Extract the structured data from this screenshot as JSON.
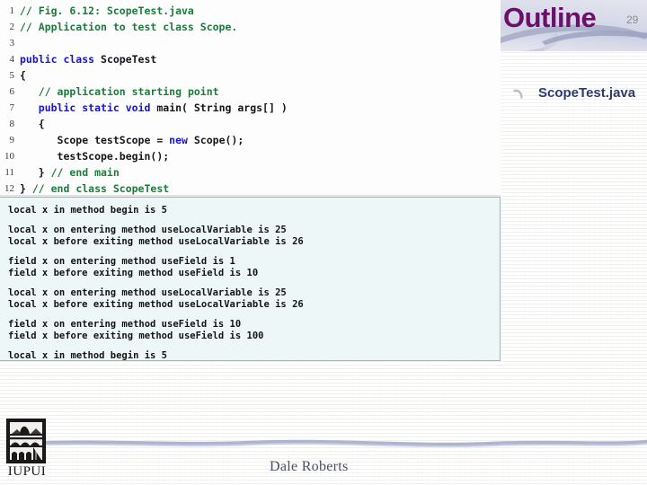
{
  "slide": {
    "page_number": "29",
    "author": "Dale Roberts"
  },
  "header": {
    "title": "Outline",
    "title_color": "#6b0f6b",
    "banner_color": "#d7d9e8"
  },
  "outline": {
    "items": [
      {
        "bullet_icon": "curved-arc-bullet-icon",
        "label": "ScopeTest.java"
      }
    ],
    "label_color": "#313a6e"
  },
  "code_panel": {
    "background": "#fdfdfd",
    "comment_color": "#1d7a3c",
    "keyword_color": "#1616c8",
    "plain_color": "#14161a",
    "lines": [
      {
        "n": "1",
        "segments": [
          {
            "t": "// Fig. 6.12: ScopeTest.java",
            "c": "cmt"
          }
        ]
      },
      {
        "n": "2",
        "segments": [
          {
            "t": "// Application to test class Scope.",
            "c": "cmt"
          }
        ]
      },
      {
        "n": "3",
        "segments": [
          {
            "t": "",
            "c": "pl"
          }
        ]
      },
      {
        "n": "4",
        "segments": [
          {
            "t": "public class ",
            "c": "kw"
          },
          {
            "t": "ScopeTest",
            "c": "pl"
          }
        ]
      },
      {
        "n": "5",
        "segments": [
          {
            "t": "{",
            "c": "pl"
          }
        ]
      },
      {
        "n": "6",
        "segments": [
          {
            "t": "   ",
            "c": "pl"
          },
          {
            "t": "// application starting point",
            "c": "cmt"
          }
        ]
      },
      {
        "n": "7",
        "segments": [
          {
            "t": "   ",
            "c": "pl"
          },
          {
            "t": "public static void ",
            "c": "kw"
          },
          {
            "t": "main( String args[] )",
            "c": "pl"
          }
        ]
      },
      {
        "n": "8",
        "segments": [
          {
            "t": "   {",
            "c": "pl"
          }
        ]
      },
      {
        "n": "9",
        "segments": [
          {
            "t": "      Scope testScope = ",
            "c": "pl"
          },
          {
            "t": "new ",
            "c": "kw"
          },
          {
            "t": "Scope();",
            "c": "pl"
          }
        ]
      },
      {
        "n": "10",
        "segments": [
          {
            "t": "      testScope.begin();",
            "c": "pl"
          }
        ]
      },
      {
        "n": "11",
        "segments": [
          {
            "t": "   } ",
            "c": "pl"
          },
          {
            "t": "// end main",
            "c": "cmt"
          }
        ]
      },
      {
        "n": "12",
        "segments": [
          {
            "t": "} ",
            "c": "pl"
          },
          {
            "t": "// end class ScopeTest",
            "c": "cmt"
          }
        ]
      }
    ]
  },
  "console_panel": {
    "background": "#eef7f7",
    "lines": [
      {
        "text": "local x in method begin is 5",
        "gap_after": true
      },
      {
        "text": "local x on entering method useLocalVariable is 25",
        "gap_after": false
      },
      {
        "text": "local x before exiting method useLocalVariable is 26",
        "gap_after": true
      },
      {
        "text": "field x on entering method useField is 1",
        "gap_after": false
      },
      {
        "text": "field x before exiting method useField is 10",
        "gap_after": true
      },
      {
        "text": "local x on entering method useLocalVariable is 25",
        "gap_after": false
      },
      {
        "text": "local x before exiting method useLocalVariable is 26",
        "gap_after": true
      },
      {
        "text": "field x on entering method useField is 10",
        "gap_after": false
      },
      {
        "text": "field x before exiting method useField is 100",
        "gap_after": true
      },
      {
        "text": "local x in method begin is 5",
        "gap_after": false
      }
    ]
  },
  "logo": {
    "wordmark": "IUPUI",
    "alt": "iupui-campus-logo"
  }
}
